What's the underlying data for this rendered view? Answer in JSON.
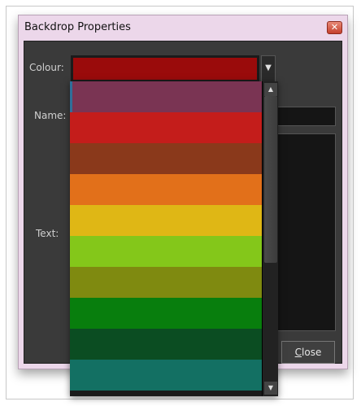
{
  "dialog": {
    "title": "Backdrop Properties",
    "close_icon": "close-icon",
    "colour_label": "Colour:",
    "name_label": "Name:",
    "text_label": "Text:",
    "selected_colour": "#9a0b0b",
    "name_value": "",
    "text_value": "",
    "close_button_label_first": "C",
    "close_button_label_rest": "lose"
  },
  "colour_dropdown": {
    "open": true,
    "options": [
      {
        "color": "#7a3453"
      },
      {
        "color": "#c41d1b"
      },
      {
        "color": "#8a391b"
      },
      {
        "color": "#e2701a"
      },
      {
        "color": "#dfb715"
      },
      {
        "color": "#84c71a"
      },
      {
        "color": "#7f8a10"
      },
      {
        "color": "#087e0d"
      },
      {
        "color": "#0b4d22"
      },
      {
        "color": "#137063"
      }
    ],
    "scroll_up_icon": "arrow-up-icon",
    "scroll_down_icon": "arrow-down-icon",
    "dropdown_icon": "chevron-down-icon"
  }
}
